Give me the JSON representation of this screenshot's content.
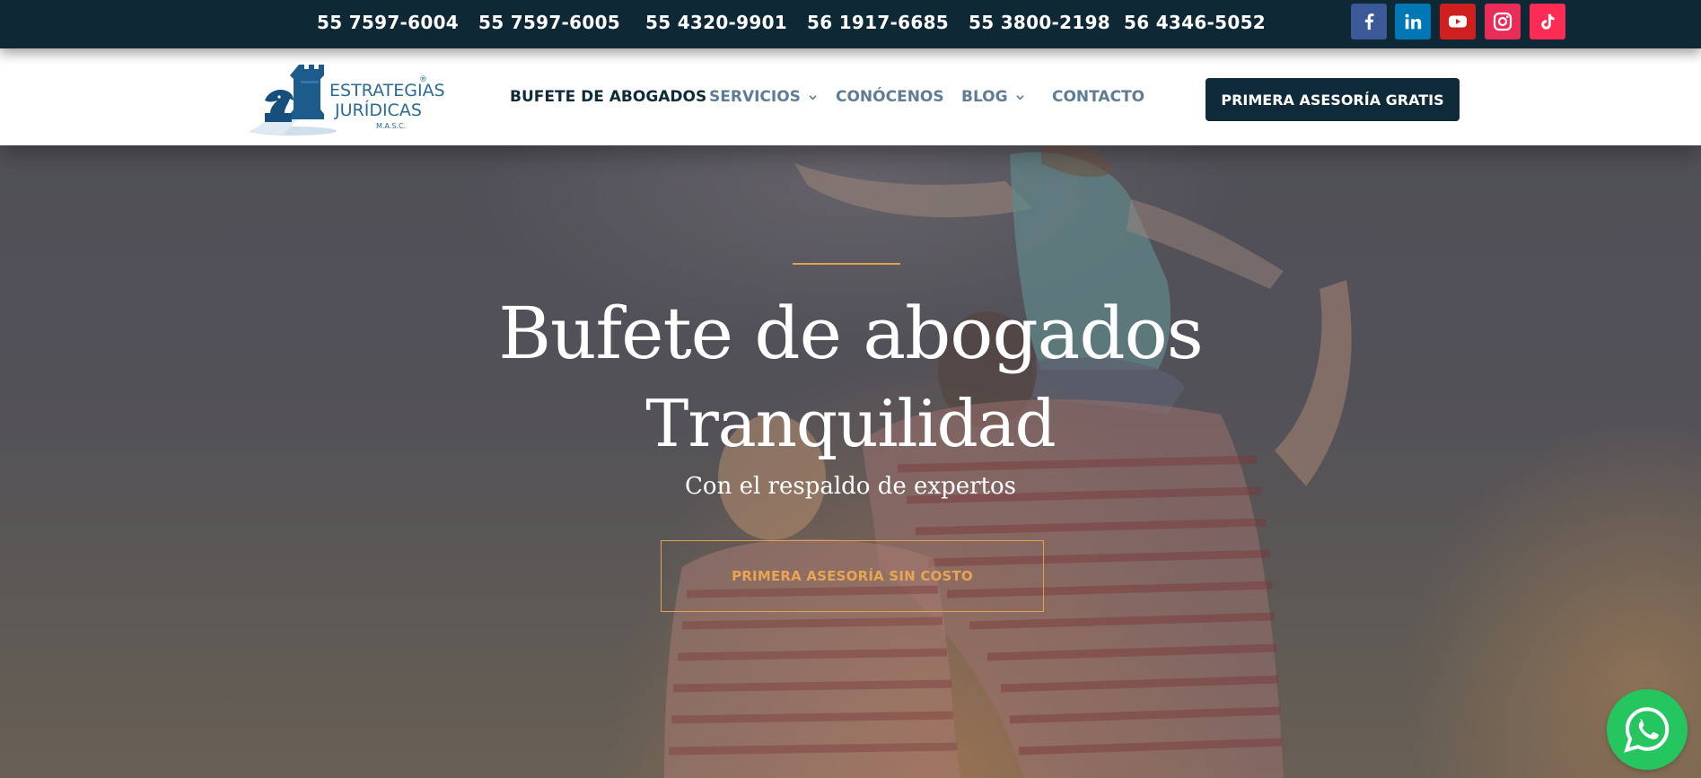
{
  "topbar": {
    "phones": [
      "55 7597-6004",
      "55 7597-6005",
      "55 4320-9901",
      "56 1917-6685",
      "55 3800-2198",
      "56 4346-5052"
    ],
    "social": [
      {
        "name": "facebook-icon",
        "color": "#3b5998"
      },
      {
        "name": "linkedin-icon",
        "color": "#0077b5"
      },
      {
        "name": "youtube-icon",
        "color": "#cd201f"
      },
      {
        "name": "instagram-icon",
        "color": "#ea2c59"
      },
      {
        "name": "tiktok-icon",
        "color": "#fe2c55"
      }
    ]
  },
  "logo": {
    "line1": "ESTRATEGIAS",
    "line2": "JURÍDICAS",
    "line3": "M.A.S.C.",
    "reg": "®"
  },
  "nav": {
    "items": [
      {
        "label": "BUFETE DE ABOGADOS",
        "active": true,
        "dropdown": false
      },
      {
        "label": "SERVICIOS",
        "active": false,
        "dropdown": true
      },
      {
        "label": "CONÓCENOS",
        "active": false,
        "dropdown": false
      },
      {
        "label": "BLOG",
        "active": false,
        "dropdown": true
      },
      {
        "label": "CONTACTO",
        "active": false,
        "dropdown": false
      }
    ],
    "cta_label": "PRIMERA ASESORÍA GRATIS"
  },
  "hero": {
    "title_line1": "Bufete de abogados",
    "title_line2": "Tranquilidad",
    "subtitle": "Con el respaldo de expertos",
    "button_label": "PRIMERA ASESORÍA SIN COSTO"
  },
  "colors": {
    "navy": "#0f2a38",
    "accent": "#e3a14d",
    "nav_text": "#5e7d94",
    "whatsapp": "#25c560"
  }
}
